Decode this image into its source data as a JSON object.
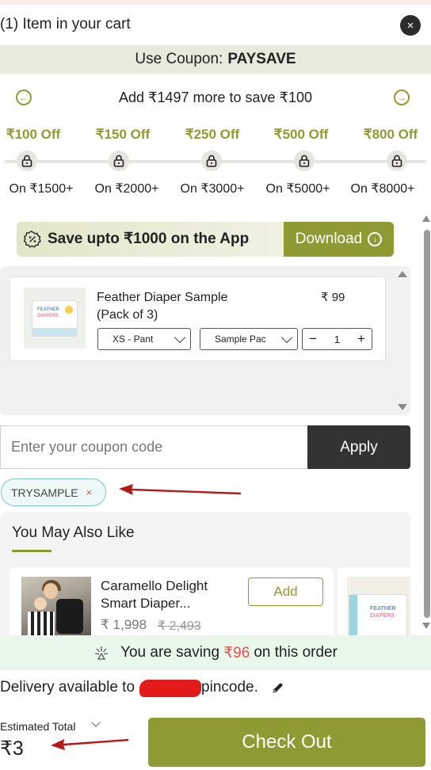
{
  "header": {
    "cart_title": "(1) Item in your cart",
    "close_symbol": "×"
  },
  "coupon_banner": {
    "prefix": "Use Coupon:",
    "code": "PAYSAVE"
  },
  "progress": {
    "message": "Add ₹1497 more to save ₹100",
    "tiers": [
      {
        "off": "₹100 Off",
        "condition": "On ₹1500+"
      },
      {
        "off": "₹150 Off",
        "condition": "On ₹2000+"
      },
      {
        "off": "₹250 Off",
        "condition": "On ₹3000+"
      },
      {
        "off": "₹500 Off",
        "condition": "On ₹5000+"
      },
      {
        "off": "₹800 Off",
        "condition": "On ₹8000+"
      }
    ]
  },
  "app_promo": {
    "text": "Save upto ₹1000 on the App",
    "download_label": "Download"
  },
  "cart_item": {
    "name": "Feather Diaper Sample (Pack of 3)",
    "price": "₹ 99",
    "size": "XS - Pant",
    "pack": "Sample Pac",
    "quantity": "1",
    "minus": "−",
    "plus": "+",
    "thumb_text_1": "FEATHER",
    "thumb_text_2": "DIAPERS"
  },
  "coupon_entry": {
    "placeholder": "Enter your coupon code",
    "apply_label": "Apply",
    "applied_code": "TRYSAMPLE",
    "remove_symbol": "×"
  },
  "suggestions": {
    "title": "You May Also Like",
    "items": [
      {
        "name": "Caramello Delight Smart Diaper...",
        "price": "₹ 1,998",
        "mrp": "₹ 2,493",
        "add_label": "Add"
      },
      {
        "thumb_text_1": "FEATHER",
        "thumb_text_2": "DIAPERS"
      }
    ]
  },
  "savings": {
    "prefix": "You are saving",
    "amount": "₹96",
    "suffix": "on this order"
  },
  "delivery": {
    "prefix": "Delivery available to",
    "suffix": "pincode."
  },
  "footer": {
    "estimated_label": "Estimated Total",
    "estimated_value": "₹3",
    "checkout_label": "Check Out"
  },
  "colors": {
    "accent_olive": "#8f9a35",
    "savings_red": "#e0504f",
    "annotation_red": "#b31b1b",
    "apply_dark": "#333333"
  }
}
